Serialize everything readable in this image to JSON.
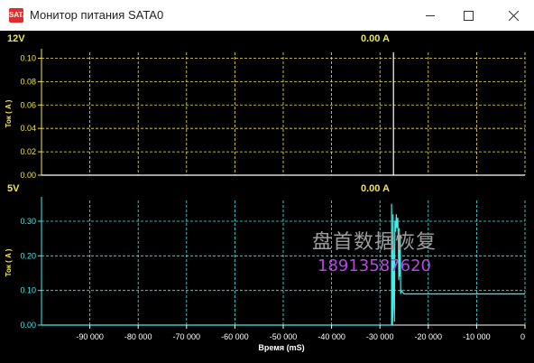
{
  "window": {
    "title": "Монитор питания SATA0",
    "icon_label": "SATA"
  },
  "panels": [
    {
      "id": "12v",
      "label": "12V",
      "current_readout": "0.00 A",
      "y_label": "Ток ( A )",
      "y_ticks": [
        "0.10",
        "0.08",
        "0.06",
        "0.04",
        "0.02",
        "0.00"
      ],
      "grid_color": "#f2e64d",
      "trace_color": "#ffffff"
    },
    {
      "id": "5v",
      "label": "5V",
      "current_readout": "0.00 A",
      "y_label": "Ток ( A )",
      "y_ticks": [
        "0.30",
        "0.20",
        "0.10",
        "0.00"
      ],
      "grid_color": "#3ff0ea",
      "trace_color": "#3ff0ea"
    }
  ],
  "x_axis": {
    "label": "Время (mS)",
    "ticks": [
      "-90 000",
      "-80 000",
      "-70 000",
      "-60 000",
      "-50 000",
      "-40 000",
      "-30 000",
      "-20 000",
      "-10 000",
      "0"
    ]
  },
  "watermark": {
    "text": "盘首数据恢复",
    "phone": "18913587620"
  },
  "chart_data": [
    {
      "type": "line",
      "title": "12V",
      "readout": "0.00 A",
      "xlabel": "",
      "ylabel": "Ток ( A )",
      "xlim": [
        -100000,
        0
      ],
      "ylim": [
        0,
        0.105
      ],
      "grid": true,
      "series": [
        {
          "x": [
            -100000,
            -27200,
            -27200,
            -27200,
            0
          ],
          "y": [
            0,
            0,
            0.105,
            0,
            0
          ]
        }
      ]
    },
    {
      "type": "line",
      "title": "5V",
      "readout": "0.00 A",
      "xlabel": "Время (mS)",
      "ylabel": "Ток ( A )",
      "xlim": [
        -100000,
        0
      ],
      "ylim": [
        0,
        0.36
      ],
      "grid": true,
      "series": [
        {
          "x": [
            -100000,
            -27600,
            -27600,
            -27400,
            -27300,
            -27300,
            -27000,
            -26900,
            -26800,
            -26600,
            -26500,
            -26300,
            -26200,
            -26100,
            -26000,
            -25900,
            -25800,
            -25700,
            -25600,
            -25000,
            -24800,
            -24700,
            0
          ],
          "y": [
            0,
            0,
            0.35,
            0,
            0.05,
            0.32,
            0.01,
            0.3,
            0.27,
            0.32,
            0.28,
            0.31,
            0.24,
            0.13,
            0.28,
            0.14,
            0.26,
            0.09,
            0.1,
            0.09,
            0.09,
            0.09,
            0.09
          ]
        }
      ]
    }
  ]
}
